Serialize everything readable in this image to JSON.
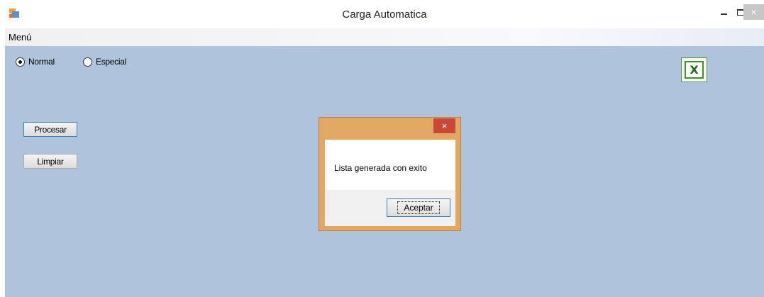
{
  "window": {
    "title": "Carga Automatica",
    "icon": "app-window-icon",
    "controls": {
      "minimize": "minimize-icon",
      "maximize": "maximize-icon",
      "close": "×"
    }
  },
  "menu": {
    "items": [
      {
        "label": "Menú"
      }
    ]
  },
  "options": {
    "normal": {
      "label": "Normal",
      "checked": true
    },
    "especial": {
      "label": "Especial",
      "checked": false
    }
  },
  "buttons": {
    "procesar": "Procesar",
    "limpiar": "Limpiar"
  },
  "excel": {
    "icon": "excel-icon",
    "glyph": "X"
  },
  "dialog": {
    "close": "×",
    "message": "Lista generada con exito",
    "ok_label": "Aceptar"
  },
  "colors": {
    "client_bg": "#afc3dd",
    "dialog_frame": "#e3a764",
    "dialog_close": "#c9483a"
  }
}
